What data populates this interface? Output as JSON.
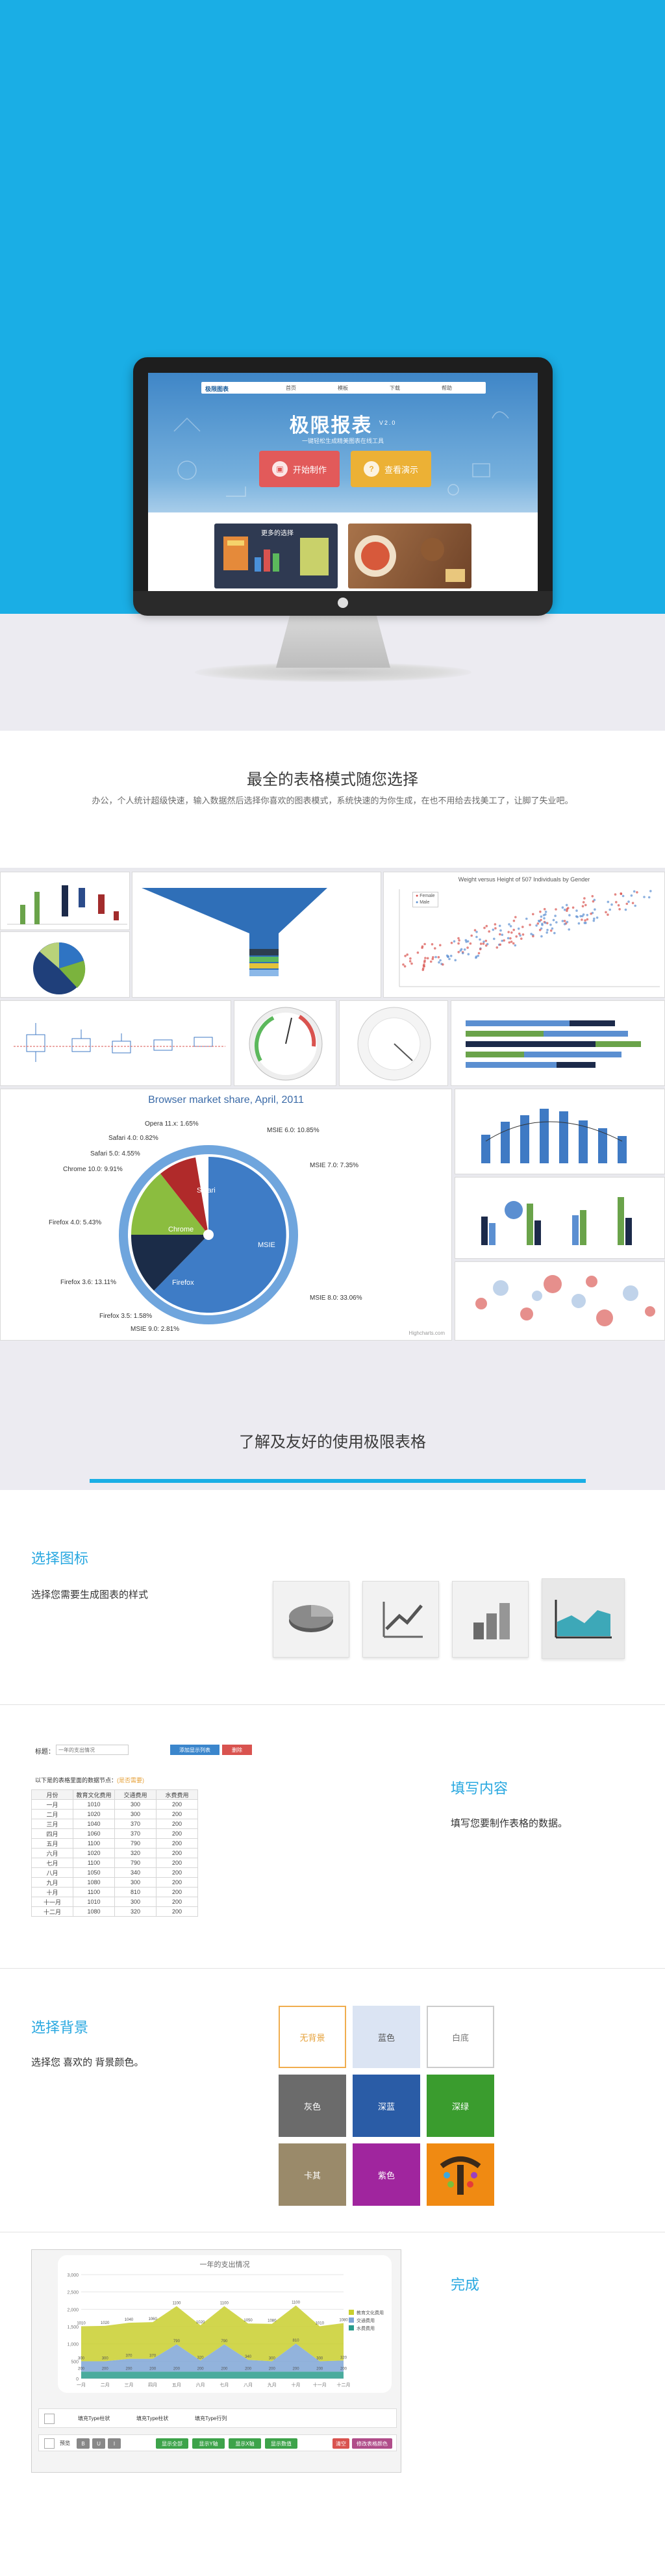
{
  "hero": {
    "screen": {
      "logo": "极限图表",
      "nav": [
        "首页",
        "模板",
        "下载",
        "帮助"
      ],
      "title": "极限报表",
      "title_badge": "V2.0",
      "subtitle": "一键轻松生成精美图表在线工具",
      "btn_start": "开始制作",
      "btn_demo": "查看演示",
      "thumb_caption": "更多的选择"
    }
  },
  "intro": {
    "title": "最全的表格模式随您选择",
    "desc": "办公，个人统计超级快速，输入数据然后选择你喜欢的图表模式，系统快速的为你生成，在也不用给去找美工了，让脚了失业吧。"
  },
  "collage": {
    "browser_title": "Browser market share, April, 2011",
    "browser_labels": [
      "Opera 11.x: 1.65%",
      "Safari 4.0: 0.82%",
      "Safari 5.0: 4.55%",
      "Chrome 10.0: 9.91%",
      "Firefox 4.0: 5.43%",
      "Firefox 3.6: 13.11%",
      "Firefox 3.5: 1.58%",
      "MSIE 9.0: 2.81%",
      "MSIE 6.0: 10.85%",
      "MSIE 7.0: 7.35%",
      "MSIE 8.0: 33.06%"
    ],
    "inner_labels": [
      "MSIE",
      "Firefox",
      "Chrome",
      "Safari"
    ],
    "credit": "Highcharts.com",
    "scatter_title": "Weight versus Height of 507 Individuals by Gender",
    "legend_female": "Female",
    "legend_male": "Male"
  },
  "about": {
    "title": "了解及友好的使用极限表格"
  },
  "steps": {
    "choose_icon": {
      "title": "选择图标",
      "desc": "选择您需要生成图表的样式"
    },
    "fill": {
      "title": "填写内容",
      "desc": "填写您要制作表格的数据。"
    },
    "background": {
      "title": "选择背景",
      "desc": "选择您 喜欢的 背景颜色。"
    },
    "done": {
      "title": "完成"
    }
  },
  "form_mock": {
    "title_label": "标题：",
    "title_placeholder": "一年的支出情况",
    "btn_add": "添加显示列表",
    "btn_del": "删除",
    "hint": "以下是的表格里面的数据节点：",
    "hint_link": "(是否需要)",
    "table": [
      [
        "月份",
        "教育文化费用",
        "交通费用",
        "水费费用"
      ],
      [
        "一月",
        "1010",
        "300",
        "200"
      ],
      [
        "二月",
        "1020",
        "300",
        "200"
      ],
      [
        "三月",
        "1040",
        "370",
        "200"
      ],
      [
        "四月",
        "1060",
        "370",
        "200"
      ],
      [
        "五月",
        "1100",
        "790",
        "200"
      ],
      [
        "六月",
        "1020",
        "320",
        "200"
      ],
      [
        "七月",
        "1100",
        "790",
        "200"
      ],
      [
        "八月",
        "1050",
        "340",
        "200"
      ],
      [
        "九月",
        "1080",
        "300",
        "200"
      ],
      [
        "十月",
        "1100",
        "810",
        "200"
      ],
      [
        "十一月",
        "1010",
        "300",
        "200"
      ],
      [
        "十二月",
        "1080",
        "320",
        "200"
      ]
    ]
  },
  "bg_tiles": [
    {
      "label": "无背景",
      "bg": "#ffffff",
      "fg": "#e6a23c",
      "border": "#f0ad4e"
    },
    {
      "label": "蓝色",
      "bg": "#dbe4f3",
      "fg": "#555555",
      "border": "#dbe4f3"
    },
    {
      "label": "白底",
      "bg": "#ffffff",
      "fg": "#777777",
      "border": "#cccccc"
    },
    {
      "label": "灰色",
      "bg": "#6b6b6b",
      "fg": "#ffffff",
      "border": "#6b6b6b"
    },
    {
      "label": "深蓝",
      "bg": "#2a5ca6",
      "fg": "#ffffff",
      "border": "#2a5ca6"
    },
    {
      "label": "深绿",
      "bg": "#3a9c2e",
      "fg": "#ffffff",
      "border": "#3a9c2e"
    },
    {
      "label": "卡其",
      "bg": "#9a8a6a",
      "fg": "#ffffff",
      "border": "#9a8a6a"
    },
    {
      "label": "紫色",
      "bg": "#a0259e",
      "fg": "#ffffff",
      "border": "#a0259e"
    },
    {
      "label": "",
      "bg": "#f08a12",
      "fg": "#ffffff",
      "border": "#f08a12"
    }
  ],
  "final_chart": {
    "title": "一年的支出情况",
    "legend": [
      "教育文化费用",
      "交通费用",
      "水费费用"
    ],
    "toolbar_row1": [
      "填充Type柱状",
      "填充Type柱状",
      "填充Type行列"
    ],
    "toolbar_row2": [
      "预览",
      "B",
      "U",
      "I",
      "显示全部",
      "显示Y轴",
      "显示X轴",
      "显示数值",
      "清空",
      "修改表格颜色"
    ]
  },
  "chart_data": {
    "type": "area",
    "title": "一年的支出情况",
    "categories": [
      "一月",
      "二月",
      "三月",
      "四月",
      "五月",
      "六月",
      "七月",
      "八月",
      "九月",
      "十月",
      "十一月",
      "十二月"
    ],
    "series": [
      {
        "name": "教育文化费用",
        "values": [
          1010,
          1020,
          1040,
          1060,
          1100,
          1020,
          1100,
          1050,
          1080,
          1100,
          1010,
          1080
        ]
      },
      {
        "name": "交通费用",
        "values": [
          300,
          300,
          370,
          370,
          790,
          320,
          790,
          340,
          300,
          810,
          300,
          320
        ]
      },
      {
        "name": "水费费用",
        "values": [
          200,
          200,
          200,
          200,
          200,
          200,
          200,
          200,
          200,
          200,
          200,
          200
        ]
      }
    ],
    "ylim": [
      0,
      3000
    ],
    "yticks": [
      0,
      500,
      1000,
      1500,
      2000,
      2500,
      3000
    ],
    "colors": [
      "#c9cf2e",
      "#7fa6d6",
      "#2a9c8c"
    ]
  }
}
